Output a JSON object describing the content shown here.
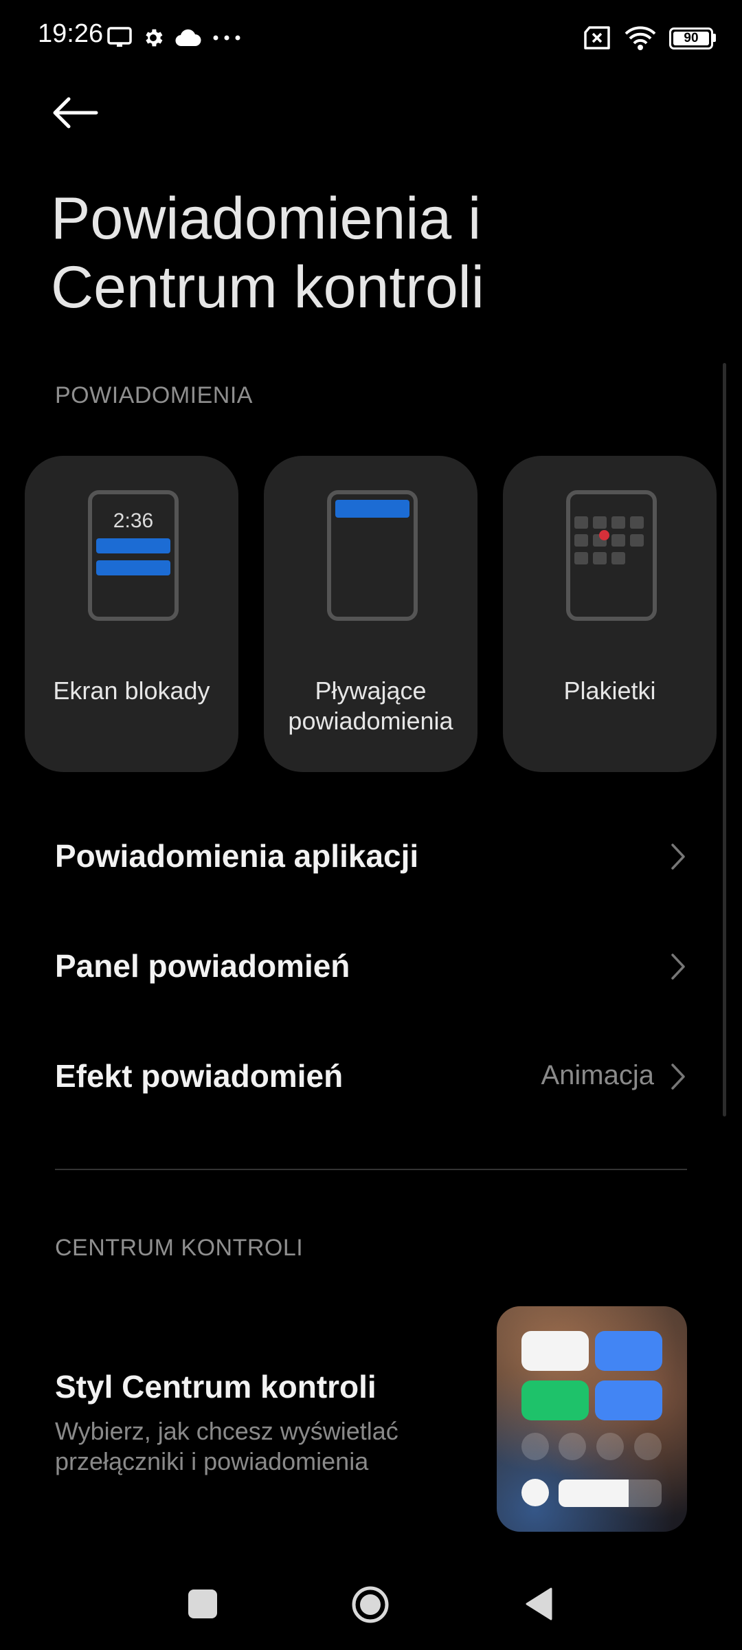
{
  "status_bar": {
    "time": "19:26",
    "battery": "90",
    "icons": [
      "screen-icon",
      "gear-icon",
      "cloud-icon",
      "more-icon",
      "no-sim-icon",
      "wifi-icon",
      "battery-icon"
    ]
  },
  "header": {
    "title_line1": "Powiadomienia i",
    "title_line2": "Centrum kontroli"
  },
  "notifications_section": {
    "header": "POWIADOMIENIA",
    "cards": [
      {
        "label": "Ekran blokady",
        "icon": "lock-screen-preview-icon",
        "preview_time": "2:36"
      },
      {
        "label_line1": "Pływające",
        "label_line2": "powiadomienia",
        "icon": "floating-notification-preview-icon"
      },
      {
        "label": "Plakietki",
        "icon": "badges-preview-icon"
      }
    ],
    "rows": [
      {
        "label": "Powiadomienia aplikacji"
      },
      {
        "label": "Panel powiadomień"
      },
      {
        "label": "Efekt powiadomień",
        "value": "Animacja"
      }
    ]
  },
  "control_center_section": {
    "header": "CENTRUM KONTROLI",
    "style_item": {
      "title": "Styl Centrum kontroli",
      "subtitle_line1": "Wybierz, jak chcesz wyświetlać",
      "subtitle_line2": "przełączniki i powiadomienia"
    }
  },
  "colors": {
    "accent_blue": "#1c6cd4",
    "badge_red": "#d6303a",
    "tile_green": "#1ec26a",
    "tile_blue": "#4285f4"
  },
  "navbar": [
    "recents-button",
    "home-button",
    "back-nav-button"
  ]
}
